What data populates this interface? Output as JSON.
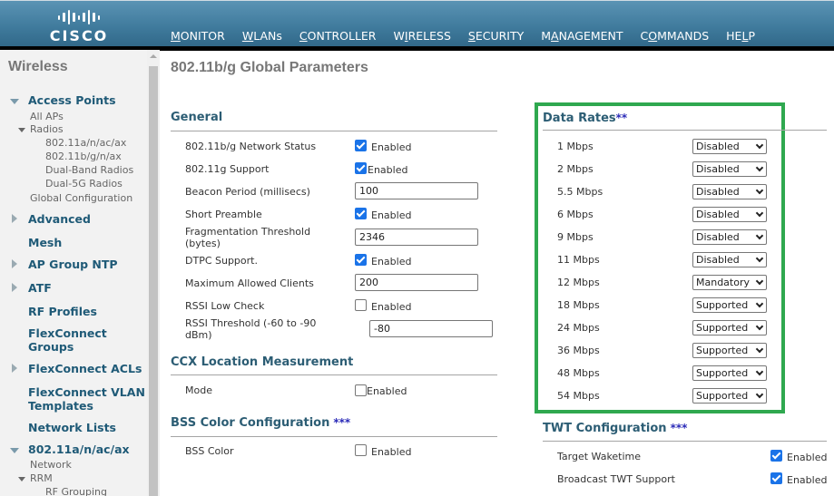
{
  "header": {
    "logo_text": "CISCO",
    "nav": [
      {
        "pre": "",
        "ul": "M",
        "post": "ONITOR",
        "active": false
      },
      {
        "pre": "",
        "ul": "W",
        "post": "LANs",
        "active": false
      },
      {
        "pre": "",
        "ul": "C",
        "post": "ONTROLLER",
        "active": false
      },
      {
        "pre": "W",
        "ul": "I",
        "post": "RELESS",
        "active": true
      },
      {
        "pre": "",
        "ul": "S",
        "post": "ECURITY",
        "active": false
      },
      {
        "pre": "M",
        "ul": "A",
        "post": "NAGEMENT",
        "active": false
      },
      {
        "pre": "C",
        "ul": "O",
        "post": "MMANDS",
        "active": false
      },
      {
        "pre": "HE",
        "ul": "L",
        "post": "P",
        "active": false
      }
    ],
    "active_color": "#f08a1c"
  },
  "sidebar": {
    "title": "Wireless",
    "access_points": "Access Points",
    "all_aps": "All APs",
    "radios": "Radios",
    "radio_items": [
      "802.11a/n/ac/ax",
      "802.11b/g/n/ax",
      "Dual-Band Radios",
      "Dual-5G Radios"
    ],
    "global_config": "Global Configuration",
    "advanced": "Advanced",
    "mesh": "Mesh",
    "ap_group_ntp": "AP Group NTP",
    "atf": "ATF",
    "rf_profiles": "RF Profiles",
    "flex_groups_1": "FlexConnect",
    "flex_groups_2": "Groups",
    "flex_acls": "FlexConnect ACLs",
    "flex_vlan_1": "FlexConnect VLAN",
    "flex_vlan_2": "Templates",
    "network_lists": "Network Lists",
    "band_a": "802.11a/n/ac/ax",
    "network": "Network",
    "rrm": "RRM",
    "rf_grouping": "RF Grouping"
  },
  "main": {
    "title": "802.11b/g Global Parameters",
    "general": {
      "title": "General",
      "network_status": {
        "label": "802.11b/g Network Status",
        "checked": true,
        "text": "Enabled"
      },
      "g_support": {
        "label": "802.11g Support",
        "checked": true,
        "text": "Enabled"
      },
      "beacon": {
        "label": "Beacon Period (millisecs)",
        "value": "100"
      },
      "short_preamble": {
        "label": "Short Preamble",
        "checked": true,
        "text": "Enabled"
      },
      "frag": {
        "label1": "Fragmentation Threshold",
        "label2": "(bytes)",
        "value": "2346"
      },
      "dtpc": {
        "label": "DTPC Support.",
        "checked": true,
        "text": "Enabled"
      },
      "max_clients": {
        "label": "Maximum Allowed Clients",
        "value": "200"
      },
      "rssi_low": {
        "label": "RSSI Low Check",
        "checked": false,
        "text": "Enabled"
      },
      "rssi_thresh": {
        "label1": "RSSI Threshold (-60 to -90",
        "label2": "dBm)",
        "value": "-80"
      }
    },
    "ccx": {
      "title": "CCX Location Measurement",
      "mode": {
        "label": "Mode",
        "checked": false,
        "text": "Enabled"
      }
    },
    "bss": {
      "title": "BSS Color Configuration",
      "stars": "***",
      "color": {
        "label": "BSS Color",
        "checked": false,
        "text": "Enabled"
      }
    },
    "data_rates": {
      "title": "Data Rates",
      "stars": "**",
      "highlight_color": "#2fa84f",
      "rates": [
        {
          "label": "1 Mbps",
          "value": "Disabled"
        },
        {
          "label": "2 Mbps",
          "value": "Disabled"
        },
        {
          "label": "5.5 Mbps",
          "value": "Disabled"
        },
        {
          "label": "6 Mbps",
          "value": "Disabled"
        },
        {
          "label": "9 Mbps",
          "value": "Disabled"
        },
        {
          "label": "11 Mbps",
          "value": "Disabled"
        },
        {
          "label": "12 Mbps",
          "value": "Mandatory"
        },
        {
          "label": "18 Mbps",
          "value": "Supported"
        },
        {
          "label": "24 Mbps",
          "value": "Supported"
        },
        {
          "label": "36 Mbps",
          "value": "Supported"
        },
        {
          "label": "48 Mbps",
          "value": "Supported"
        },
        {
          "label": "54 Mbps",
          "value": "Supported"
        }
      ]
    },
    "twt": {
      "title": "TWT Configuration",
      "stars": "***",
      "target_waketime": {
        "label": "Target Waketime",
        "checked": true,
        "text": "Enabled"
      },
      "broadcast": {
        "label": "Broadcast TWT Support",
        "checked": true,
        "text": "Enabled"
      }
    }
  }
}
